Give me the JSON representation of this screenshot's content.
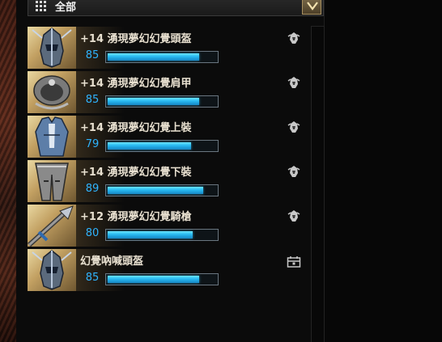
{
  "filter": {
    "label": "全部",
    "icon": "grid-icon",
    "toggle_icon": "chevron-down-icon"
  },
  "items": [
    {
      "name": "+14 湧現夢幻幻覺頭盔",
      "level": "85",
      "progress": 0.84,
      "icon": "helmet-icon",
      "tag_icon": "guild-emblem-icon"
    },
    {
      "name": "+14 湧現夢幻幻覺肩甲",
      "level": "85",
      "progress": 0.84,
      "icon": "pauldron-icon",
      "tag_icon": "guild-emblem-icon"
    },
    {
      "name": "+14 湧現夢幻幻覺上裝",
      "level": "79",
      "progress": 0.77,
      "icon": "chest-armor-icon",
      "tag_icon": "guild-emblem-icon"
    },
    {
      "name": "+14 湧現夢幻幻覺下裝",
      "level": "89",
      "progress": 0.88,
      "icon": "leg-armor-icon",
      "tag_icon": "guild-emblem-icon"
    },
    {
      "name": "+12 湧現夢幻幻覺騎槍",
      "level": "80",
      "progress": 0.78,
      "icon": "lance-icon",
      "tag_icon": "guild-emblem-icon"
    },
    {
      "name": "幻覺吶喊頭盔",
      "level": "85",
      "progress": 0.84,
      "icon": "helmet-icon",
      "tag_icon": "account-chest-icon"
    }
  ],
  "colors": {
    "accent_level": "#2fb4ff",
    "bar_fill": "#27b8f0",
    "thumb_gold": "#c2a062"
  }
}
